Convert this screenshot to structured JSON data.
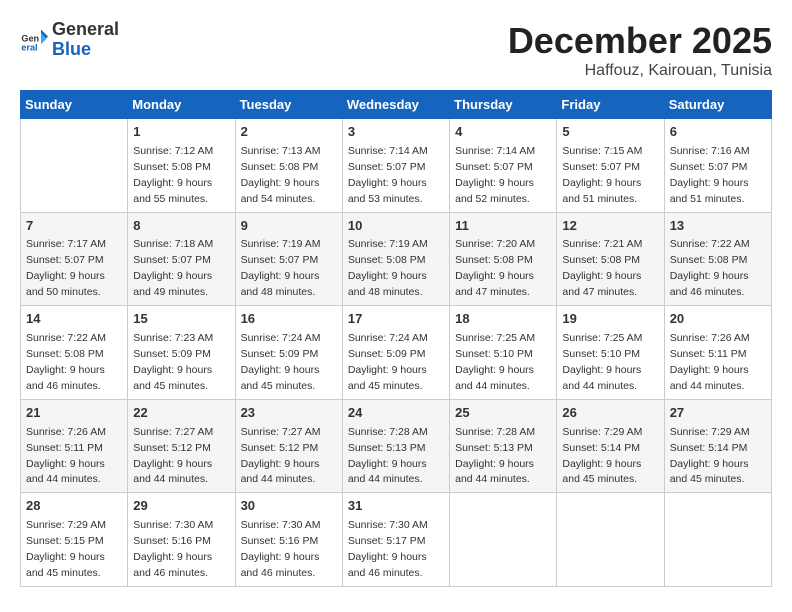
{
  "header": {
    "logo_general": "General",
    "logo_blue": "Blue",
    "month_year": "December 2025",
    "location": "Haffouz, Kairouan, Tunisia"
  },
  "days_of_week": [
    "Sunday",
    "Monday",
    "Tuesday",
    "Wednesday",
    "Thursday",
    "Friday",
    "Saturday"
  ],
  "weeks": [
    [
      {
        "day": "",
        "empty": true
      },
      {
        "day": "1",
        "sunrise": "7:12 AM",
        "sunset": "5:08 PM",
        "daylight": "9 hours and 55 minutes."
      },
      {
        "day": "2",
        "sunrise": "7:13 AM",
        "sunset": "5:08 PM",
        "daylight": "9 hours and 54 minutes."
      },
      {
        "day": "3",
        "sunrise": "7:14 AM",
        "sunset": "5:07 PM",
        "daylight": "9 hours and 53 minutes."
      },
      {
        "day": "4",
        "sunrise": "7:14 AM",
        "sunset": "5:07 PM",
        "daylight": "9 hours and 52 minutes."
      },
      {
        "day": "5",
        "sunrise": "7:15 AM",
        "sunset": "5:07 PM",
        "daylight": "9 hours and 51 minutes."
      },
      {
        "day": "6",
        "sunrise": "7:16 AM",
        "sunset": "5:07 PM",
        "daylight": "9 hours and 51 minutes."
      }
    ],
    [
      {
        "day": "7",
        "sunrise": "7:17 AM",
        "sunset": "5:07 PM",
        "daylight": "9 hours and 50 minutes."
      },
      {
        "day": "8",
        "sunrise": "7:18 AM",
        "sunset": "5:07 PM",
        "daylight": "9 hours and 49 minutes."
      },
      {
        "day": "9",
        "sunrise": "7:19 AM",
        "sunset": "5:07 PM",
        "daylight": "9 hours and 48 minutes."
      },
      {
        "day": "10",
        "sunrise": "7:19 AM",
        "sunset": "5:08 PM",
        "daylight": "9 hours and 48 minutes."
      },
      {
        "day": "11",
        "sunrise": "7:20 AM",
        "sunset": "5:08 PM",
        "daylight": "9 hours and 47 minutes."
      },
      {
        "day": "12",
        "sunrise": "7:21 AM",
        "sunset": "5:08 PM",
        "daylight": "9 hours and 47 minutes."
      },
      {
        "day": "13",
        "sunrise": "7:22 AM",
        "sunset": "5:08 PM",
        "daylight": "9 hours and 46 minutes."
      }
    ],
    [
      {
        "day": "14",
        "sunrise": "7:22 AM",
        "sunset": "5:08 PM",
        "daylight": "9 hours and 46 minutes."
      },
      {
        "day": "15",
        "sunrise": "7:23 AM",
        "sunset": "5:09 PM",
        "daylight": "9 hours and 45 minutes."
      },
      {
        "day": "16",
        "sunrise": "7:24 AM",
        "sunset": "5:09 PM",
        "daylight": "9 hours and 45 minutes."
      },
      {
        "day": "17",
        "sunrise": "7:24 AM",
        "sunset": "5:09 PM",
        "daylight": "9 hours and 45 minutes."
      },
      {
        "day": "18",
        "sunrise": "7:25 AM",
        "sunset": "5:10 PM",
        "daylight": "9 hours and 44 minutes."
      },
      {
        "day": "19",
        "sunrise": "7:25 AM",
        "sunset": "5:10 PM",
        "daylight": "9 hours and 44 minutes."
      },
      {
        "day": "20",
        "sunrise": "7:26 AM",
        "sunset": "5:11 PM",
        "daylight": "9 hours and 44 minutes."
      }
    ],
    [
      {
        "day": "21",
        "sunrise": "7:26 AM",
        "sunset": "5:11 PM",
        "daylight": "9 hours and 44 minutes."
      },
      {
        "day": "22",
        "sunrise": "7:27 AM",
        "sunset": "5:12 PM",
        "daylight": "9 hours and 44 minutes."
      },
      {
        "day": "23",
        "sunrise": "7:27 AM",
        "sunset": "5:12 PM",
        "daylight": "9 hours and 44 minutes."
      },
      {
        "day": "24",
        "sunrise": "7:28 AM",
        "sunset": "5:13 PM",
        "daylight": "9 hours and 44 minutes."
      },
      {
        "day": "25",
        "sunrise": "7:28 AM",
        "sunset": "5:13 PM",
        "daylight": "9 hours and 44 minutes."
      },
      {
        "day": "26",
        "sunrise": "7:29 AM",
        "sunset": "5:14 PM",
        "daylight": "9 hours and 45 minutes."
      },
      {
        "day": "27",
        "sunrise": "7:29 AM",
        "sunset": "5:14 PM",
        "daylight": "9 hours and 45 minutes."
      }
    ],
    [
      {
        "day": "28",
        "sunrise": "7:29 AM",
        "sunset": "5:15 PM",
        "daylight": "9 hours and 45 minutes."
      },
      {
        "day": "29",
        "sunrise": "7:30 AM",
        "sunset": "5:16 PM",
        "daylight": "9 hours and 46 minutes."
      },
      {
        "day": "30",
        "sunrise": "7:30 AM",
        "sunset": "5:16 PM",
        "daylight": "9 hours and 46 minutes."
      },
      {
        "day": "31",
        "sunrise": "7:30 AM",
        "sunset": "5:17 PM",
        "daylight": "9 hours and 46 minutes."
      },
      {
        "day": "",
        "empty": true
      },
      {
        "day": "",
        "empty": true
      },
      {
        "day": "",
        "empty": true
      }
    ]
  ]
}
